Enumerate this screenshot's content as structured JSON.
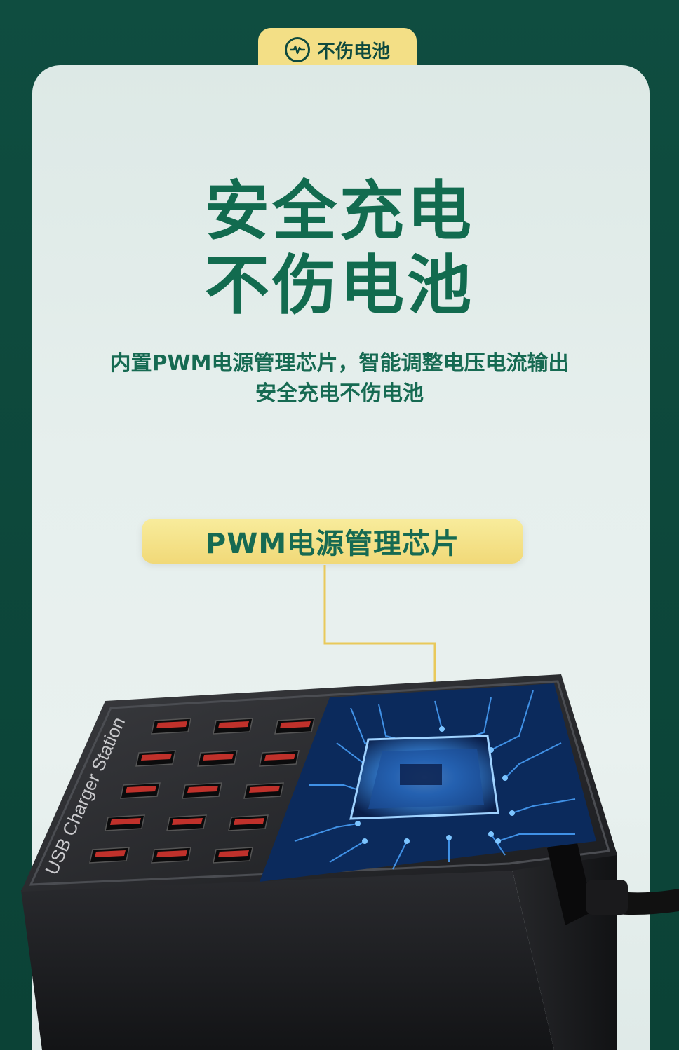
{
  "top_tab": {
    "icon": "pulse-circle-icon",
    "label": "不伤电池"
  },
  "headline": {
    "line1": "安全充电",
    "line2": "不伤电池"
  },
  "subtitle": {
    "line1": "内置PWM电源管理芯片，智能调整电压电流输出",
    "line2": "安全充电不伤电池"
  },
  "callout": {
    "label": "PWM电源管理芯片"
  },
  "product": {
    "name_text": "USB Charger Station",
    "usb_port_count": 15,
    "colors": {
      "accent_green": "#126b4f",
      "accent_yellow": "#f3df86",
      "port_red": "#c0312b",
      "body_dark": "#1e1f22",
      "circuit_blue": "#2f7fd9"
    }
  }
}
